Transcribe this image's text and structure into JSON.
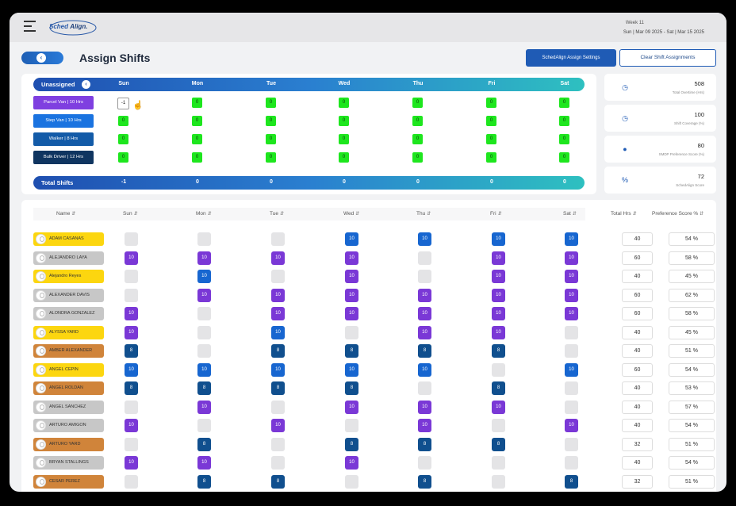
{
  "header": {
    "logo_a": "Sched",
    "logo_b": "Align.",
    "week_label": "Week 11",
    "date_range": "Sun | Mar 09 2025 - Sat | Mar 15 2025"
  },
  "page": {
    "title": "Assign Shifts",
    "back_icon": "chevron-left",
    "settings_button": "SchedAlign Assign Settings",
    "clear_button": "Clear Shift Assignments"
  },
  "unassigned": {
    "label": "Unassigned",
    "days": [
      "Sun",
      "Mon",
      "Tue",
      "Wed",
      "Thu",
      "Fri",
      "Sat"
    ],
    "vehicles": [
      {
        "label": "Parcel Van | 10 Hrs",
        "color": "#7f3fe0",
        "values": [
          "-1",
          "0",
          "0",
          "0",
          "0",
          "0",
          "0"
        ]
      },
      {
        "label": "Step Van | 10 Hrs",
        "color": "#1a73e0",
        "values": [
          "0",
          "0",
          "0",
          "0",
          "0",
          "0",
          "0"
        ]
      },
      {
        "label": "Walker | 8 Hrs",
        "color": "#135ba8",
        "values": [
          "0",
          "0",
          "0",
          "0",
          "0",
          "0",
          "0"
        ]
      },
      {
        "label": "Bulk Driver | 12 Hrs",
        "color": "#0f3560",
        "values": [
          "0",
          "0",
          "0",
          "0",
          "0",
          "0",
          "0"
        ]
      }
    ],
    "totals_label": "Total Shifts",
    "totals": [
      "-1",
      "0",
      "0",
      "0",
      "0",
      "0",
      "0"
    ]
  },
  "metrics": [
    {
      "icon": "clock-icon",
      "value": "508",
      "label": "Total Overtime (Hrs)"
    },
    {
      "icon": "clock-icon",
      "value": "100",
      "label": "Shift Coverage (%)"
    },
    {
      "icon": "palette-icon",
      "value": "80",
      "label": "SMDP Preference Score (%)"
    },
    {
      "icon": "percent-icon",
      "value": "72",
      "label": "SchedAlign Score"
    }
  ],
  "roster": {
    "headers": {
      "name": "Name",
      "days": [
        "Sun",
        "Mon",
        "Tue",
        "Wed",
        "Thu",
        "Fri",
        "Sat"
      ],
      "total": "Total Hrs",
      "pref": "Preference Score %"
    },
    "employees": [
      {
        "name": "ADAM CASANAS",
        "tag": "yellow",
        "shifts": [
          "",
          "",
          "",
          "10b",
          "10b",
          "10b",
          "10b"
        ],
        "total": "40",
        "pref": "54 %"
      },
      {
        "name": "ALEJANDRO LAYA",
        "tag": "gray",
        "shifts": [
          "10",
          "10",
          "10",
          "10",
          "",
          "10",
          "10"
        ],
        "total": "60",
        "pref": "58 %"
      },
      {
        "name": "Alejandro Reyes",
        "tag": "yellow",
        "shifts": [
          "",
          "10b",
          "",
          "10",
          "",
          "10",
          "10"
        ],
        "total": "40",
        "pref": "45 %"
      },
      {
        "name": "ALEXANDER DAVIS",
        "tag": "gray",
        "shifts": [
          "",
          "10",
          "10",
          "10",
          "10",
          "10",
          "10"
        ],
        "total": "60",
        "pref": "62 %"
      },
      {
        "name": "ALONDRA GONZALEZ",
        "tag": "gray",
        "shifts": [
          "10",
          "",
          "10",
          "10",
          "10",
          "10",
          "10"
        ],
        "total": "60",
        "pref": "58 %"
      },
      {
        "name": "ALYSSA YARD",
        "tag": "yellow",
        "shifts": [
          "10",
          "",
          "10b",
          "",
          "10",
          "10",
          ""
        ],
        "total": "40",
        "pref": "45 %"
      },
      {
        "name": "AMBER ALEXANDER",
        "tag": "orange",
        "shifts": [
          "8",
          "",
          "8",
          "8",
          "8",
          "8",
          ""
        ],
        "total": "40",
        "pref": "51 %"
      },
      {
        "name": "ANGEL CEPIN",
        "tag": "yellow",
        "shifts": [
          "10b",
          "10b",
          "10b",
          "10b",
          "10b",
          "",
          "10b"
        ],
        "total": "60",
        "pref": "54 %"
      },
      {
        "name": "ANGEL ROLDAN",
        "tag": "orange",
        "shifts": [
          "8",
          "8",
          "8",
          "8",
          "",
          "8",
          ""
        ],
        "total": "40",
        "pref": "53 %"
      },
      {
        "name": "ANGEL SANCHEZ",
        "tag": "gray",
        "shifts": [
          "",
          "10",
          "",
          "10",
          "10",
          "10",
          ""
        ],
        "total": "40",
        "pref": "57 %"
      },
      {
        "name": "ARTURO AMIGON",
        "tag": "gray",
        "shifts": [
          "10",
          "",
          "10",
          "",
          "10",
          "",
          "10"
        ],
        "total": "40",
        "pref": "54 %"
      },
      {
        "name": "ARTURO YARD",
        "tag": "orange",
        "shifts": [
          "",
          "8",
          "",
          "8",
          "8",
          "8",
          ""
        ],
        "total": "32",
        "pref": "51 %"
      },
      {
        "name": "BRYAN STALLINGS",
        "tag": "gray",
        "shifts": [
          "10",
          "10",
          "",
          "10",
          "",
          "",
          ""
        ],
        "total": "40",
        "pref": "54 %"
      },
      {
        "name": "CESAR PEREZ",
        "tag": "orange",
        "shifts": [
          "",
          "8",
          "8",
          "",
          "8",
          "",
          "8"
        ],
        "total": "32",
        "pref": "51 %"
      }
    ]
  }
}
